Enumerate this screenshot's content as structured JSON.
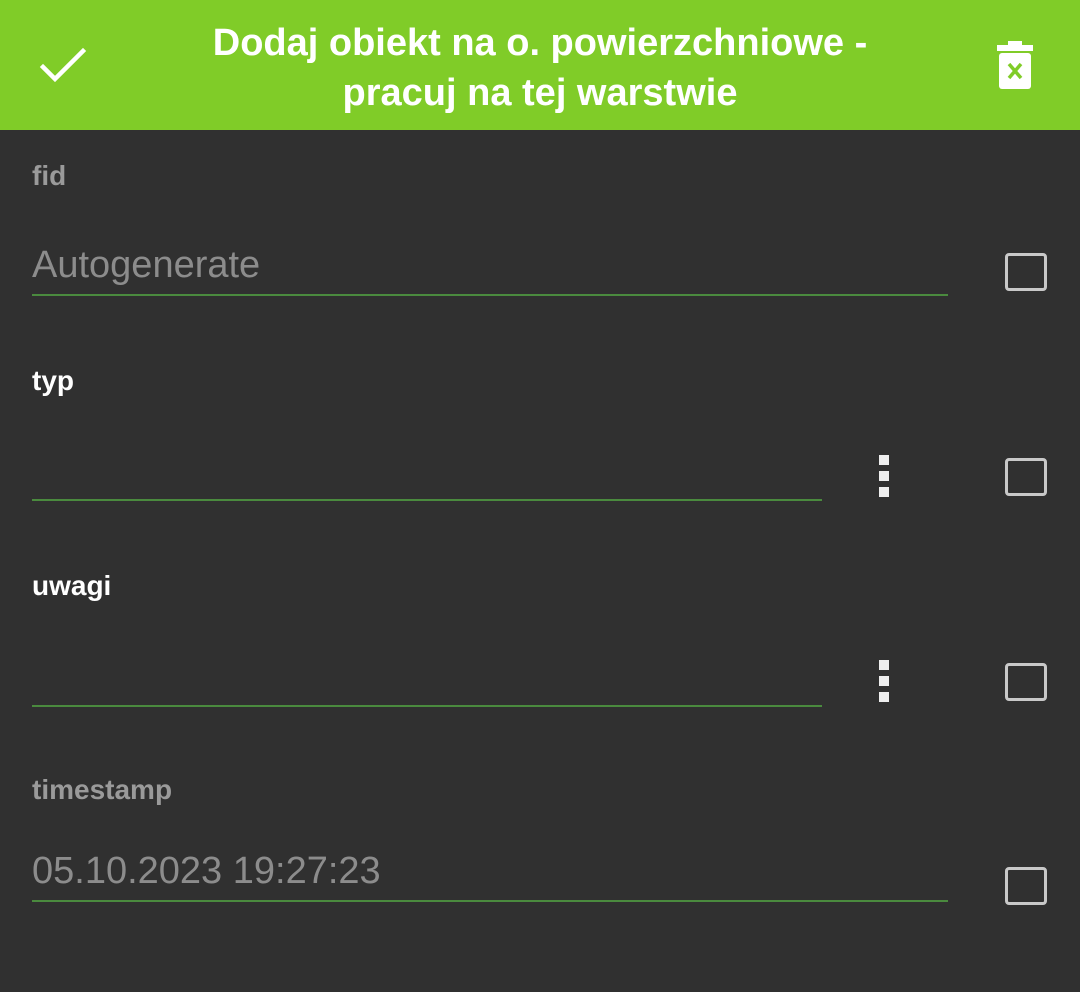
{
  "toolbar": {
    "title_line1": "Dodaj obiekt na o. powierzchniowe -",
    "title_line2": "pracuj na tej warstwie",
    "confirm_icon": "check-icon",
    "delete_icon": "trash-icon",
    "background_color": "#80cc28"
  },
  "fields": [
    {
      "label": "fid",
      "value": "Autogenerate",
      "editable": false,
      "has_menu": false
    },
    {
      "label": "typ",
      "value": "",
      "editable": true,
      "has_menu": true
    },
    {
      "label": "uwagi",
      "value": "",
      "editable": true,
      "has_menu": true
    },
    {
      "label": "timestamp",
      "value": "05.10.2023 19:27:23",
      "editable": false,
      "has_menu": false
    }
  ],
  "colors": {
    "background": "#303030",
    "underline": "#4a8a3e",
    "muted_text": "#8c8c8c"
  }
}
